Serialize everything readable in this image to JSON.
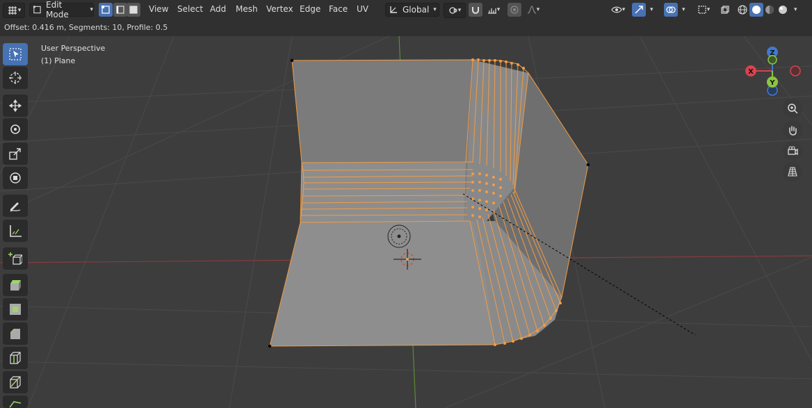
{
  "header": {
    "mode_label": "Edit Mode",
    "menus": [
      "View",
      "Select",
      "Add",
      "Mesh",
      "Vertex",
      "Edge",
      "Face",
      "UV"
    ],
    "orientation_label": "Global"
  },
  "status": {
    "operator_text": "Offset: 0.416 m, Segments: 10, Profile: 0.5"
  },
  "viewport": {
    "view_name": "User Perspective",
    "object_name": "(1) Plane"
  },
  "gizmo": {
    "x_label": "X",
    "y_label": "Y",
    "z_label": "Z",
    "x_color": "#d8434f",
    "y_color": "#8ac63f",
    "z_color": "#3f7ad4"
  },
  "colors": {
    "select_accent": "#4772b3",
    "mesh_face": "#8e8e8e",
    "edge_selected": "#f39c44"
  },
  "icons": {
    "toolbar": [
      "select-box-icon",
      "cursor-icon",
      "move-icon",
      "rotate-icon",
      "scale-icon",
      "transform-icon",
      "annotate-icon",
      "measure-icon",
      "add-cube-icon",
      "extrude-icon",
      "inset-icon",
      "bevel-icon",
      "loop-cut-icon",
      "knife-icon",
      "poly-build-icon"
    ],
    "nav": [
      "zoom-icon",
      "pan-hand-icon",
      "camera-icon",
      "ortho-grid-icon"
    ]
  }
}
